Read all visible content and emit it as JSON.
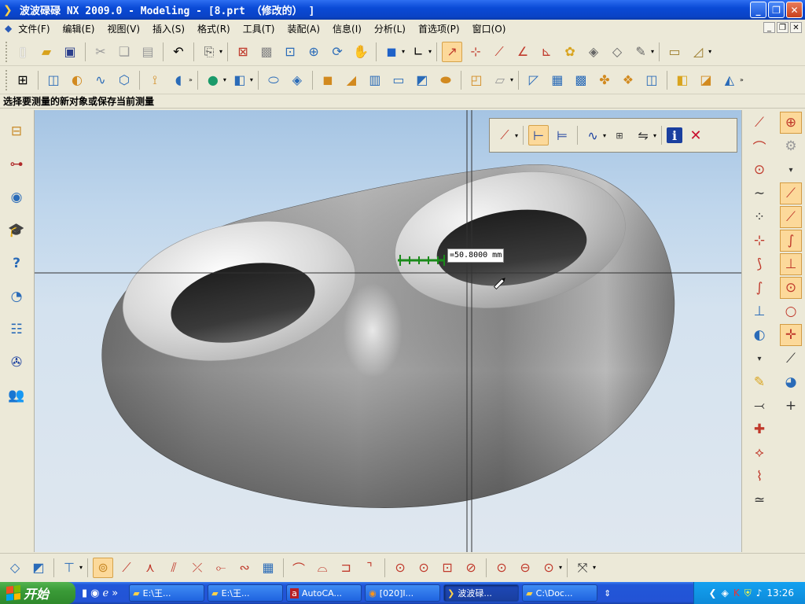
{
  "window": {
    "title": "波波碌碌 NX 2009.0 - Modeling - [8.prt （修改的） ]"
  },
  "menu": [
    "文件(F)",
    "编辑(E)",
    "视图(V)",
    "插入(S)",
    "格式(R)",
    "工具(T)",
    "装配(A)",
    "信息(I)",
    "分析(L)",
    "首选项(P)",
    "窗口(O)"
  ],
  "prompt": "选择要测量的新对象或保存当前测量",
  "measurement": {
    "value": "=50.8000 mm"
  },
  "taskbar": {
    "start_label": "开始",
    "tasks": [
      "E:\\王...",
      "E:\\王...",
      "AutoCA...",
      "[020]I...",
      "波波碌...",
      "C:\\Doc..."
    ],
    "active_task_index": 4,
    "clock": "13:26"
  },
  "colors": {
    "accent": "#0a4ad6",
    "selected": "#fcd99a",
    "measure_line": "#1a8a1a",
    "cancel": "#c8102e"
  },
  "icons": {
    "toolbar1": [
      "new-file-icon",
      "open-folder-icon",
      "save-icon",
      "cut-icon",
      "copy-icon",
      "paste-icon",
      "undo-icon",
      "command-finder-icon",
      "fit-view-icon",
      "zoom-window-icon",
      "zoom-icon",
      "zoom-in-icon",
      "rotate-icon",
      "pan-icon",
      "shaded-cube-icon",
      "wcs-icon",
      "snap-select-icon",
      "point-icon",
      "line-segment-icon",
      "angle-icon",
      "distance-icon",
      "palette-icon",
      "render-icon",
      "material-icon",
      "camera-icon",
      "ruler-icon",
      "measure-angle-icon"
    ],
    "toolbar2": [
      "part-navigator-icon",
      "extrude-icon",
      "revolve-icon",
      "sweep-icon",
      "tube-icon",
      "draft-icon",
      "blend-icon",
      "sphere-icon",
      "block-icon",
      "cylinder-icon",
      "cone-icon",
      "hole-icon",
      "boss-icon",
      "pocket-icon",
      "pad-icon",
      "slot-icon",
      "groove-icon",
      "chamfer-icon",
      "shell-icon",
      "trim-body-icon",
      "split-body-icon",
      "surface-icon",
      "mesh-icon",
      "through-curves-icon",
      "offset-surface-icon",
      "sew-icon",
      "patch-icon",
      "unite-icon",
      "subtract-icon",
      "intersect-icon"
    ],
    "bottom": [
      "sketch-icon",
      "plane-icon",
      "datum-icon",
      "constraint-icon",
      "line-icon",
      "arc-icon",
      "profile-icon",
      "rectangle-icon",
      "polygon-icon",
      "spline-icon",
      "fillet-icon",
      "trim-icon",
      "extend-icon",
      "circle-icon",
      "circle-center-icon",
      "circle-3pt-icon",
      "point-circle-icon",
      "conic-icon",
      "ellipse-icon",
      "quick-trim-icon"
    ]
  }
}
